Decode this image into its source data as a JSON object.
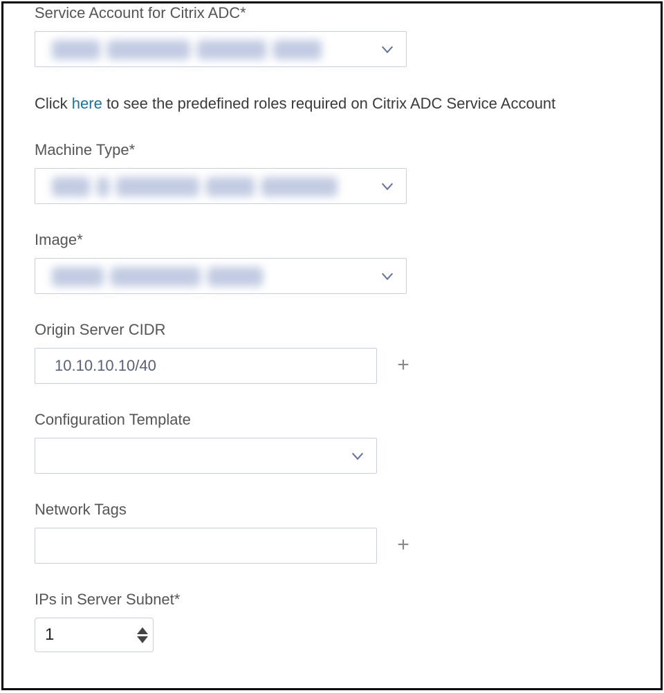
{
  "labels": {
    "service_account": "Service Account for Citrix ADC*",
    "machine_type": "Machine Type*",
    "image": "Image*",
    "origin_cidr": "Origin Server CIDR",
    "config_template": "Configuration Template",
    "network_tags": "Network Tags",
    "ips_subnet": "IPs in Server Subnet*"
  },
  "hint": {
    "prefix": "Click ",
    "link": "here",
    "suffix": " to see the predefined roles required on Citrix ADC Service Account"
  },
  "values": {
    "service_account": "",
    "machine_type": "",
    "image": "",
    "origin_cidr": "10.10.10.10/40",
    "config_template": "",
    "network_tags": "",
    "ips_subnet": "1"
  },
  "icons": {
    "plus": "+"
  }
}
